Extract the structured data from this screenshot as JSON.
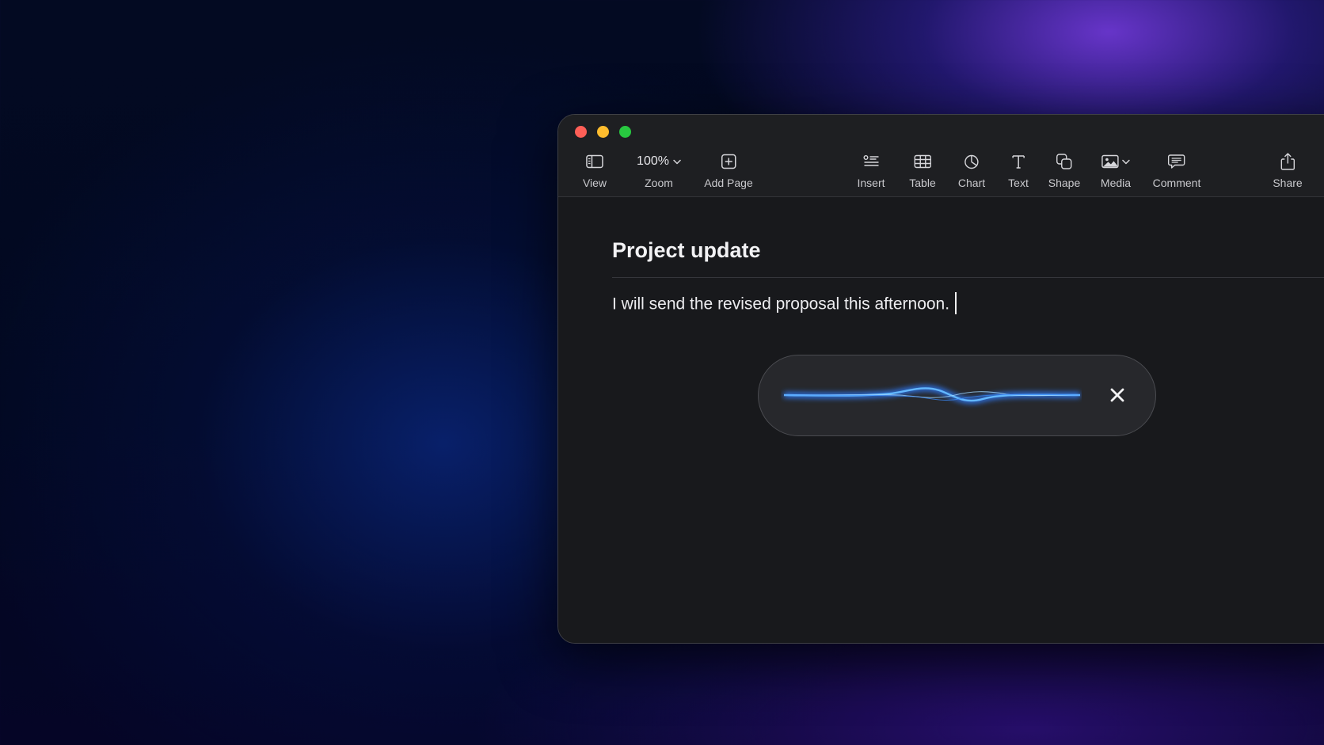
{
  "window": {
    "traffic_lights": {
      "close_color": "#fe5f57",
      "minimize_color": "#febc2e",
      "zoom_color": "#28c840"
    }
  },
  "toolbar": {
    "view": {
      "label": "View",
      "icon": "sidebar-icon"
    },
    "zoom": {
      "value": "100%",
      "label": "Zoom",
      "icon": "chevron-down-icon"
    },
    "add_page": {
      "label": "Add Page",
      "icon": "add-page-icon"
    },
    "insert": {
      "label": "Insert",
      "icon": "insert-list-icon"
    },
    "table": {
      "label": "Table",
      "icon": "table-icon"
    },
    "chart": {
      "label": "Chart",
      "icon": "pie-chart-icon"
    },
    "text": {
      "label": "Text",
      "icon": "text-icon"
    },
    "shape": {
      "label": "Shape",
      "icon": "shape-icon"
    },
    "media": {
      "label": "Media",
      "icon": "photo-icon"
    },
    "comment": {
      "label": "Comment",
      "icon": "speech-bubble-icon"
    },
    "share": {
      "label": "Share",
      "icon": "share-icon"
    }
  },
  "document": {
    "title": "Project update",
    "body": "I will send the revised proposal this afternoon."
  },
  "dictation": {
    "waveform_color": "#4aa6ff",
    "close_icon": "close-icon"
  }
}
